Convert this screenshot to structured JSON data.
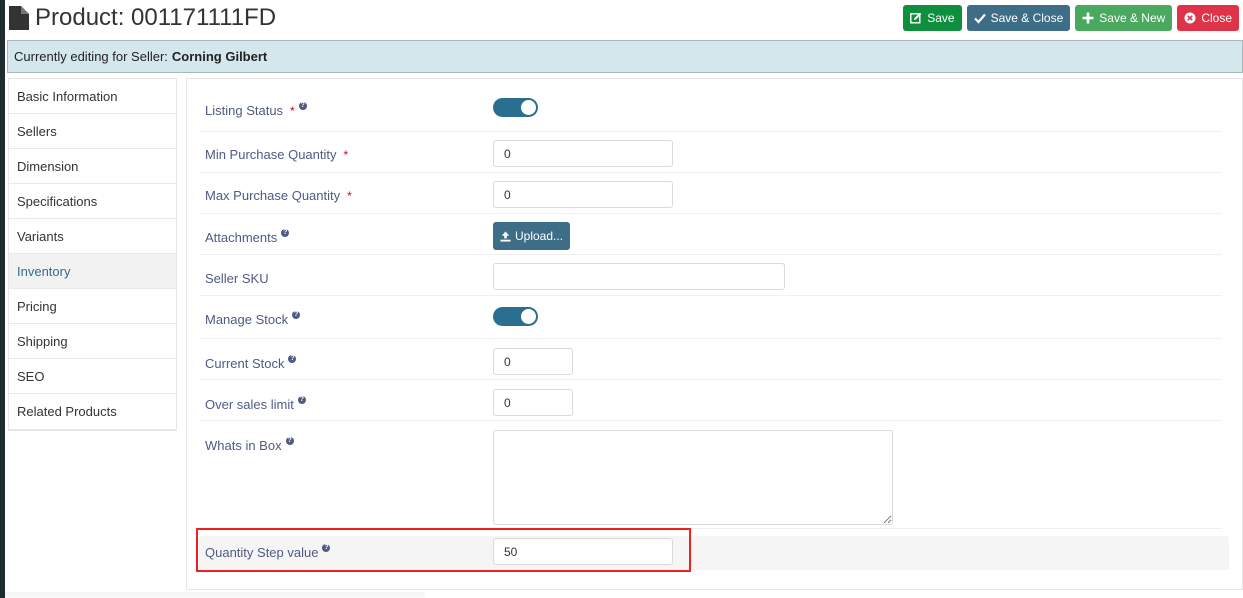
{
  "header": {
    "title": "Product: 001171111FD",
    "icon": "document-icon",
    "buttons": {
      "save": "Save",
      "save_close": "Save & Close",
      "save_new": "Save & New",
      "close": "Close"
    }
  },
  "seller_bar": {
    "prefix": "Currently editing for Seller:",
    "seller_name": "Corning Gilbert"
  },
  "sidebar": {
    "active": "Inventory",
    "items": [
      {
        "label": "Basic Information"
      },
      {
        "label": "Sellers"
      },
      {
        "label": "Dimension"
      },
      {
        "label": "Specifications"
      },
      {
        "label": "Variants"
      },
      {
        "label": "Inventory"
      },
      {
        "label": "Pricing"
      },
      {
        "label": "Shipping"
      },
      {
        "label": "SEO"
      },
      {
        "label": "Related Products"
      }
    ]
  },
  "form": {
    "listing_status": {
      "label": "Listing Status",
      "required": "*",
      "help": "?",
      "enabled": true
    },
    "min_qty": {
      "label": "Min Purchase Quantity",
      "required": "*",
      "value": "0"
    },
    "max_qty": {
      "label": "Max Purchase Quantity",
      "required": "*",
      "value": "0"
    },
    "attachments": {
      "label": "Attachments",
      "help": "?",
      "button": "Upload..."
    },
    "seller_sku": {
      "label": "Seller SKU",
      "value": ""
    },
    "manage_stock": {
      "label": "Manage Stock",
      "help": "?",
      "enabled": true
    },
    "current_stock": {
      "label": "Current Stock",
      "help": "?",
      "value": "0"
    },
    "over_sales_limit": {
      "label": "Over sales limit",
      "help": "?",
      "value": "0"
    },
    "whats_in_box": {
      "label": "Whats in Box",
      "help": "?",
      "value": ""
    },
    "quantity_step": {
      "label": "Quantity Step value",
      "help": "?",
      "value": "50"
    }
  },
  "colors": {
    "accent": "#2a6f8f",
    "save": "#0f8f3e",
    "save_close": "#3e6d87",
    "save_new": "#4aa85f",
    "close": "#de3348",
    "highlight": "#ee2020"
  }
}
